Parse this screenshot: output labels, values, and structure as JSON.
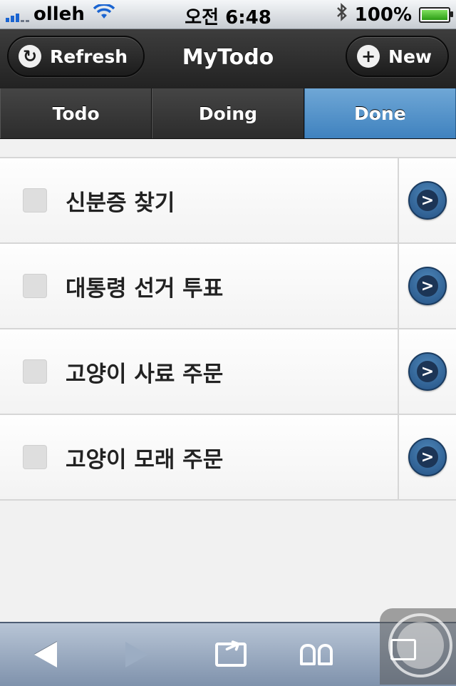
{
  "status_bar": {
    "carrier": "olleh",
    "time": "오전 6:48",
    "battery_percent": "100%"
  },
  "header": {
    "title": "MyTodo",
    "refresh_label": "Refresh",
    "new_label": "New"
  },
  "tabs": [
    {
      "label": "Todo",
      "active": false
    },
    {
      "label": "Doing",
      "active": false
    },
    {
      "label": "Done",
      "active": true
    }
  ],
  "items": [
    {
      "label": "신분증 찾기",
      "checked": false
    },
    {
      "label": "대통령 선거 투표",
      "checked": false
    },
    {
      "label": "고양이 사료 주문",
      "checked": false
    },
    {
      "label": "고양이 모래 주문",
      "checked": false
    }
  ],
  "colors": {
    "active_tab": "#4f90c8",
    "header_bg": "#2a2a2a",
    "detail_arrow": "#2c5c8f"
  },
  "toolbar": {
    "icons": [
      "back-icon",
      "forward-icon",
      "share-icon",
      "bookmarks-icon",
      "pages-icon"
    ]
  }
}
